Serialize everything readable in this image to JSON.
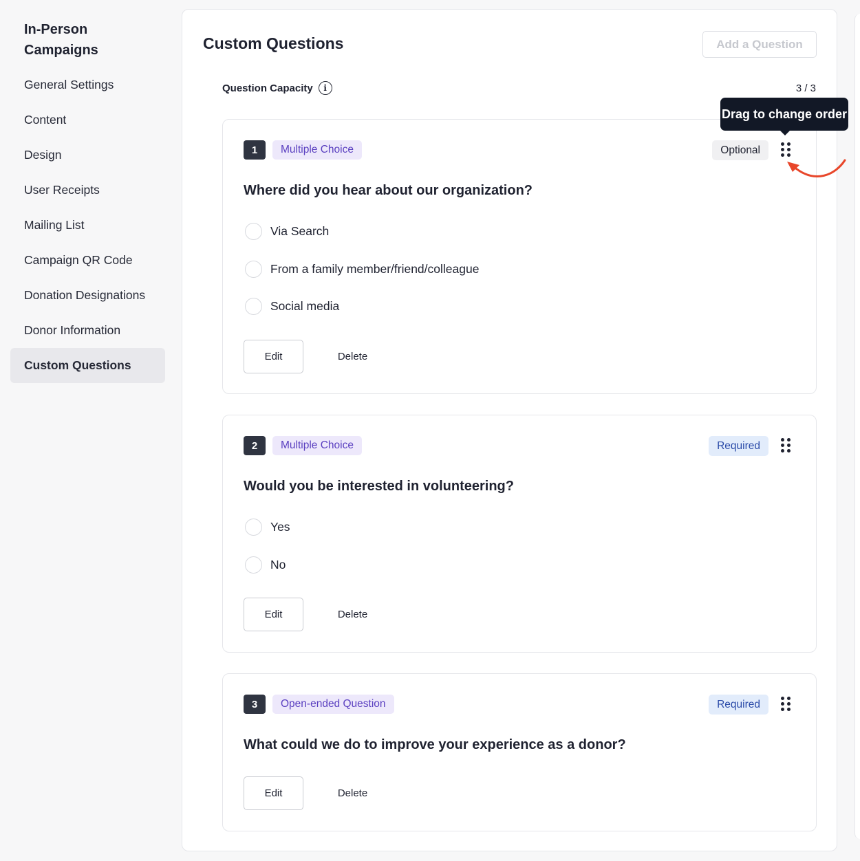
{
  "sidebar": {
    "title": "In-Person Campaigns",
    "items": [
      {
        "label": "General Settings"
      },
      {
        "label": "Content"
      },
      {
        "label": "Design"
      },
      {
        "label": "User Receipts"
      },
      {
        "label": "Mailing List"
      },
      {
        "label": "Campaign QR Code"
      },
      {
        "label": "Donation Designations"
      },
      {
        "label": "Donor Information"
      },
      {
        "label": "Custom Questions",
        "active": true
      }
    ]
  },
  "main": {
    "title": "Custom Questions",
    "add_button": "Add a Question",
    "capacity_label": "Question Capacity",
    "capacity_count": "3 / 3",
    "tooltip": "Drag to change order",
    "questions": [
      {
        "number": "1",
        "type": "Multiple Choice",
        "status": "Optional",
        "text": "Where did you hear about our organization?",
        "options": [
          "Via Search",
          "From a family member/friend/colleague",
          "Social media"
        ],
        "edit_label": "Edit",
        "delete_label": "Delete"
      },
      {
        "number": "2",
        "type": "Multiple Choice",
        "status": "Required",
        "text": "Would you be interested in volunteering?",
        "options": [
          "Yes",
          "No"
        ],
        "edit_label": "Edit",
        "delete_label": "Delete"
      },
      {
        "number": "3",
        "type": "Open-ended Question",
        "status": "Required",
        "text": "What could we do to improve your experience as a donor?",
        "options": [],
        "edit_label": "Edit",
        "delete_label": "Delete"
      }
    ]
  },
  "colors": {
    "accent_purple": "#5a3fc0",
    "required_blue": "#2a4aa8",
    "annotation_arrow": "#e8462a"
  }
}
